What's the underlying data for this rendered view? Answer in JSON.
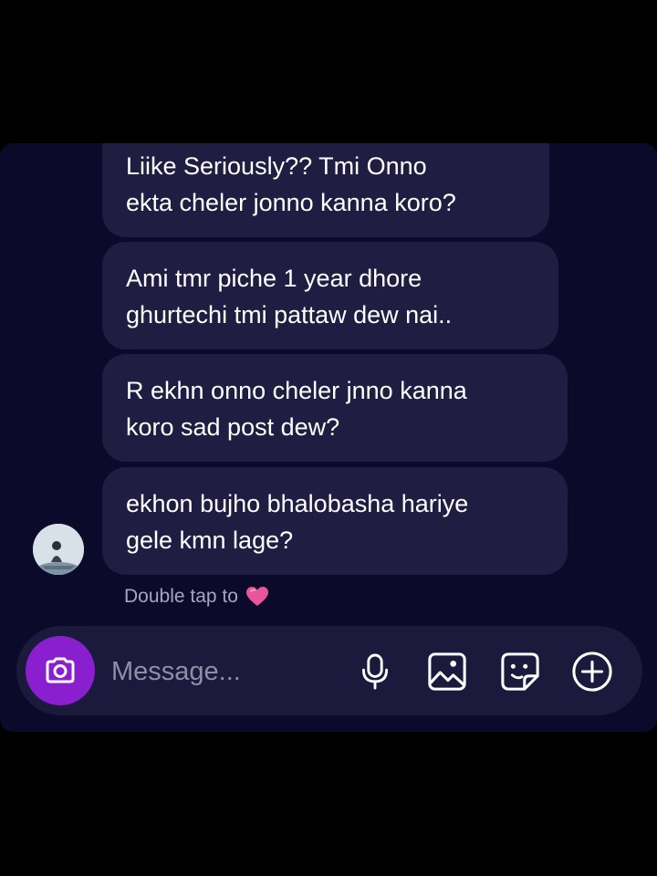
{
  "messages": [
    {
      "text": "Liike Seriously?? Tmi Onno\nekta cheler jonno kanna koro?"
    },
    {
      "text": "Ami tmr piche 1 year dhore\nghurtechi tmi pattaw dew nai.."
    },
    {
      "text": "R ekhn onno cheler jnno kanna\nkoro sad post dew?"
    },
    {
      "text": "ekhon bujho bhalobasha hariye\ngele kmn lage?"
    }
  ],
  "reaction_hint": {
    "label": "Double tap to",
    "icon": "pink-heart-icon"
  },
  "composer": {
    "placeholder": "Message...",
    "buttons": [
      "camera-icon",
      "microphone-icon",
      "gallery-icon",
      "sticker-icon",
      "plus-icon"
    ]
  },
  "colors": {
    "background": "#000000",
    "panel": "#0b0a2a",
    "bubble": "#1f1e42",
    "composer": "#1b1a3c",
    "camera_button": "#8a1fcf",
    "heart": "#e8559a"
  }
}
